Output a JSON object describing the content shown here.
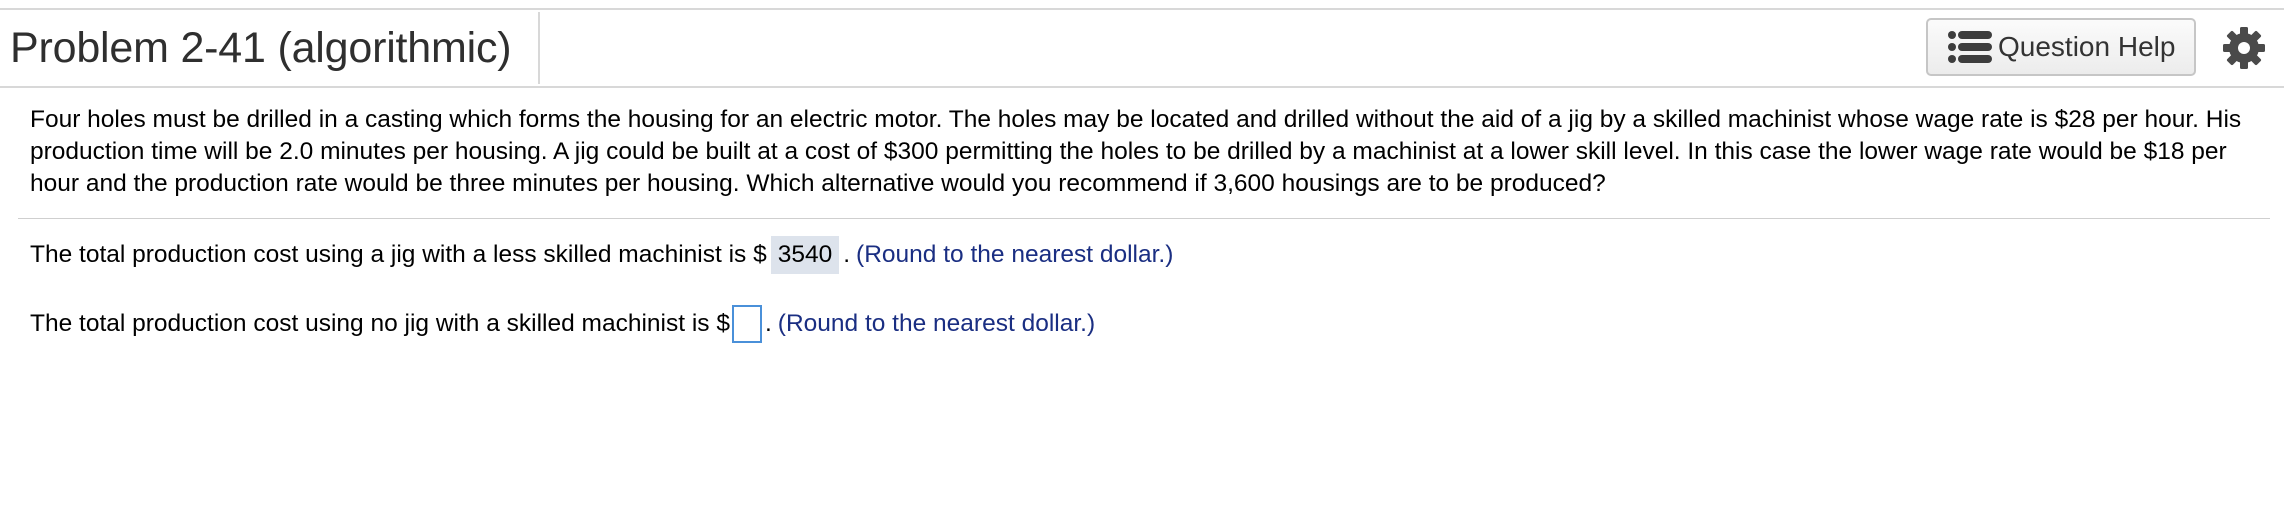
{
  "header": {
    "title": "Problem 2-41 (algorithmic)",
    "help_button_label": "Question Help",
    "help_icon": "list-icon",
    "settings_icon": "gear-icon"
  },
  "problem": {
    "text": "Four holes must be drilled in a casting which forms the housing for an electric motor. The holes may be located and drilled without the aid of a jig by a skilled machinist whose wage rate is $28 per hour. His production time will be 2.0 minutes per housing. A jig could be built at a cost of $300 permitting the holes to be drilled by a machinist at a lower skill level. In this case the lower wage rate would be $18 per hour and the production rate would be three minutes per housing. Which alternative would you recommend if 3,600 housings are to be produced?"
  },
  "questions": [
    {
      "prefix": "The total production cost using a jig with a less skilled machinist is $",
      "answer": "3540",
      "suffix": ".",
      "hint": "(Round to the nearest dollar.)"
    },
    {
      "prefix": "The total production cost using no jig with a skilled machinist is $",
      "answer": "",
      "suffix": ".",
      "hint": "(Round to the nearest dollar.)"
    }
  ],
  "colors": {
    "hint_text": "#1a2e82",
    "filled_answer_bg": "#dde3ec",
    "input_border": "#4a90d9"
  }
}
